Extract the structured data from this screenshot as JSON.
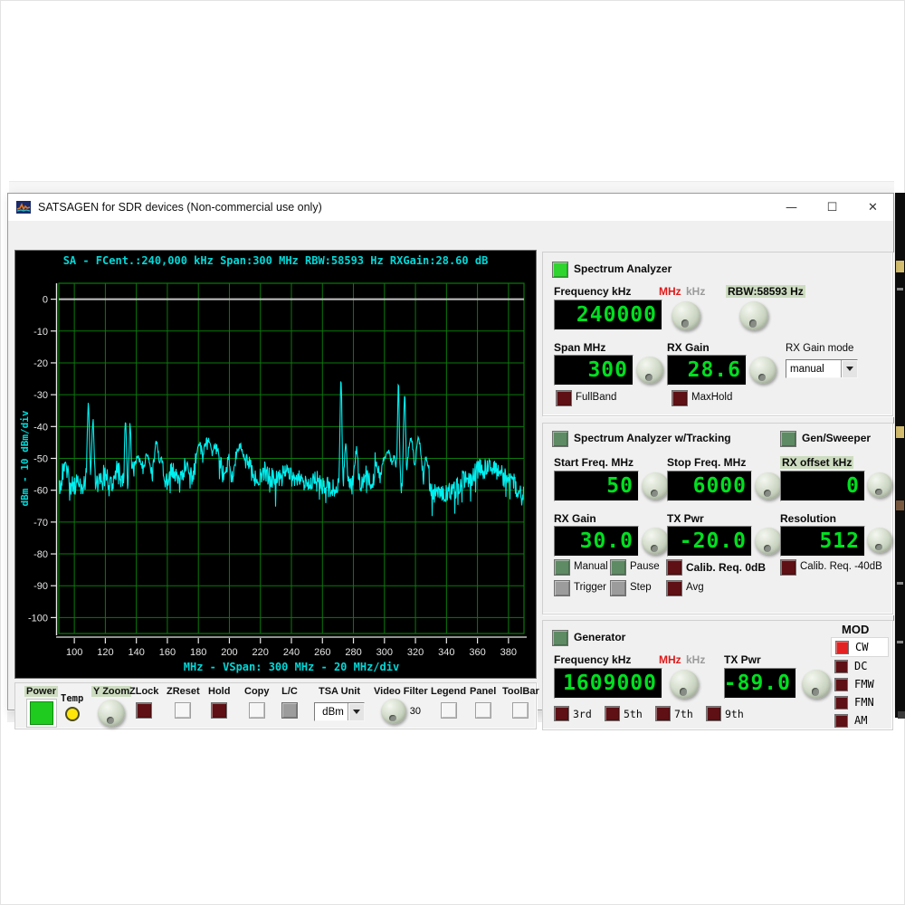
{
  "window": {
    "title": "SATSAGEN for SDR devices (Non-commercial use only)",
    "controls": {
      "minimize": "—",
      "maximize": "☐",
      "close": "✕"
    }
  },
  "spectrum": {
    "header": "SA - FCent.:240,000 kHz Span:300 MHz RBW:58593 Hz RXGain:28.60 dB",
    "chart_data": {
      "type": "line",
      "title": "SA - FCent.:240,000 kHz Span:300 MHz RBW:58593 Hz RXGain:28.60 dB",
      "xlabel": "MHz - VSpan: 300 MHz - 20 MHz/div",
      "ylabel": "dBm - 10 dBm/div",
      "xlim": [
        90,
        390
      ],
      "ylim": [
        -105,
        5
      ],
      "x_ticks": [
        100,
        120,
        140,
        160,
        180,
        200,
        220,
        240,
        260,
        280,
        300,
        320,
        340,
        360,
        380
      ],
      "y_ticks": [
        0,
        -10,
        -20,
        -30,
        -40,
        -50,
        -60,
        -70,
        -80,
        -90,
        -100
      ],
      "grid": true,
      "legend_position": "none",
      "grid_color": "#0b7a0b",
      "trace_color": "#00f0f0",
      "zero_line_dbm": 0,
      "noise_db": 3.2,
      "baseline_points": [
        [
          90,
          -59
        ],
        [
          105,
          -58
        ],
        [
          125,
          -58
        ],
        [
          158,
          -59
        ],
        [
          178,
          -57
        ],
        [
          200,
          -56
        ],
        [
          222,
          -56
        ],
        [
          248,
          -57
        ],
        [
          262,
          -59
        ],
        [
          292,
          -59
        ],
        [
          305,
          -58
        ],
        [
          330,
          -61
        ],
        [
          345,
          -60
        ],
        [
          358,
          -57
        ],
        [
          372,
          -56
        ],
        [
          382,
          -58
        ],
        [
          390,
          -61
        ]
      ],
      "peaks": [
        {
          "mhz": 94,
          "dbm": -51,
          "w": 1.5
        },
        {
          "mhz": 109,
          "dbm": -33,
          "w": 0.7
        },
        {
          "mhz": 112,
          "dbm": -38,
          "w": 0.7
        },
        {
          "mhz": 120,
          "dbm": -54,
          "w": 1.5
        },
        {
          "mhz": 128,
          "dbm": -53,
          "w": 1.5
        },
        {
          "mhz": 133,
          "dbm": -38,
          "w": 0.6
        },
        {
          "mhz": 136,
          "dbm": -39,
          "w": 0.6
        },
        {
          "mhz": 141,
          "dbm": -50,
          "w": 3
        },
        {
          "mhz": 147,
          "dbm": -49,
          "w": 2
        },
        {
          "mhz": 153,
          "dbm": -45,
          "w": 1.5
        },
        {
          "mhz": 156,
          "dbm": -50,
          "w": 1.5
        },
        {
          "mhz": 163,
          "dbm": -53,
          "w": 2
        },
        {
          "mhz": 172,
          "dbm": -52,
          "w": 2
        },
        {
          "mhz": 181,
          "dbm": -46,
          "w": 2.5
        },
        {
          "mhz": 186,
          "dbm": -44,
          "w": 3
        },
        {
          "mhz": 191,
          "dbm": -46,
          "w": 2.5
        },
        {
          "mhz": 199,
          "dbm": -51,
          "w": 2
        },
        {
          "mhz": 207,
          "dbm": -46,
          "w": 2.5
        },
        {
          "mhz": 212,
          "dbm": -50,
          "w": 1.5
        },
        {
          "mhz": 222,
          "dbm": -54,
          "w": 2
        },
        {
          "mhz": 237,
          "dbm": -51,
          "w": 1.5
        },
        {
          "mhz": 256,
          "dbm": -55,
          "w": 2
        },
        {
          "mhz": 272,
          "dbm": -25,
          "w": 0.6
        },
        {
          "mhz": 275,
          "dbm": -46,
          "w": 0.8
        },
        {
          "mhz": 282,
          "dbm": -47,
          "w": 1
        },
        {
          "mhz": 288,
          "dbm": -54,
          "w": 1.5
        },
        {
          "mhz": 295,
          "dbm": -52,
          "w": 1.5
        },
        {
          "mhz": 302,
          "dbm": -48,
          "w": 3
        },
        {
          "mhz": 306,
          "dbm": -50,
          "w": 2
        },
        {
          "mhz": 309,
          "dbm": -27,
          "w": 0.6
        },
        {
          "mhz": 313,
          "dbm": -30,
          "w": 0.7
        },
        {
          "mhz": 317,
          "dbm": -43,
          "w": 1.8
        },
        {
          "mhz": 322,
          "dbm": -44,
          "w": 1.8
        },
        {
          "mhz": 327,
          "dbm": -50,
          "w": 1.5
        },
        {
          "mhz": 352,
          "dbm": -56,
          "w": 2.5
        },
        {
          "mhz": 361,
          "dbm": -53,
          "w": 3
        },
        {
          "mhz": 367,
          "dbm": -52,
          "w": 3
        },
        {
          "mhz": 373,
          "dbm": -53,
          "w": 2.5
        },
        {
          "mhz": 380,
          "dbm": -55,
          "w": 2
        }
      ]
    }
  },
  "toolbar": {
    "power": {
      "label": "Power"
    },
    "temp": {
      "label": "Temp"
    },
    "yzoom": {
      "label": "Y Zoom"
    },
    "zlock": {
      "label": "ZLock"
    },
    "zreset": {
      "label": "ZReset"
    },
    "hold": {
      "label": "Hold"
    },
    "copy": {
      "label": "Copy"
    },
    "lc": {
      "label": "L/C"
    },
    "tsa": {
      "label": "TSA Unit",
      "value": "dBm"
    },
    "video_filter": {
      "label": "Video Filter",
      "value": "30"
    },
    "legend": {
      "label": "Legend"
    },
    "panel": {
      "label": "Panel"
    },
    "toolbar_btn": {
      "label": "ToolBar"
    }
  },
  "panels": {
    "sa": {
      "title": "Spectrum Analyzer",
      "frequency_label": "Frequency kHz",
      "mhz_label": "MHz",
      "khz_label": "kHz",
      "rbw_label": "RBW:58593 Hz",
      "frequency_value": "240000",
      "span_label": "Span MHz",
      "span_value": "300",
      "rx_gain_label": "RX Gain",
      "rx_gain_value": "28.6",
      "rx_gain_mode_label": "RX Gain mode",
      "rx_gain_mode_value": "manual",
      "fullband_label": "FullBand",
      "maxhold_label": "MaxHold"
    },
    "tracking": {
      "title": "Spectrum Analyzer w/Tracking",
      "gen_sweeper_label": "Gen/Sweeper",
      "start_freq_label": "Start Freq. MHz",
      "start_freq_value": "50",
      "stop_freq_label": "Stop Freq. MHz",
      "stop_freq_value": "6000",
      "rx_offset_label": "RX offset kHz",
      "rx_offset_value": "0",
      "rx_gain_label": "RX Gain",
      "rx_gain_value": "30.0",
      "tx_pwr_label": "TX Pwr",
      "tx_pwr_value": "-20.0",
      "resolution_label": "Resolution",
      "resolution_value": "512",
      "manual_label": "Manual",
      "pause_label": "Pause",
      "calib0_label": "Calib. Req. 0dB",
      "calib40_label": "Calib. Req. -40dB",
      "trigger_label": "Trigger",
      "step_label": "Step",
      "avg_label": "Avg"
    },
    "generator": {
      "title": "Generator",
      "frequency_label": "Frequency kHz",
      "mhz_label": "MHz",
      "khz_label": "kHz",
      "frequency_value": "1609000",
      "tx_pwr_label": "TX Pwr",
      "tx_pwr_value": "-89.0",
      "harmonics": [
        {
          "label": "3rd"
        },
        {
          "label": "5th"
        },
        {
          "label": "7th"
        },
        {
          "label": "9th"
        }
      ],
      "mod": {
        "label": "MOD",
        "items": [
          {
            "label": "CW",
            "selected": true
          },
          {
            "label": "DC"
          },
          {
            "label": "FMW"
          },
          {
            "label": "FMN"
          },
          {
            "label": "AM"
          }
        ]
      }
    }
  },
  "colors": {
    "trace": "#00f0f0",
    "grid": "#0b7a0b",
    "header_cyan": "#00d9d9",
    "display_green": "#00df20",
    "bright_green": "#2fd42f",
    "sage_green": "#5e8a64",
    "maroon": "#5e1014",
    "bright_red": "#e32222",
    "highlight": "#cddcc0",
    "yellow": "#ffe60a"
  }
}
